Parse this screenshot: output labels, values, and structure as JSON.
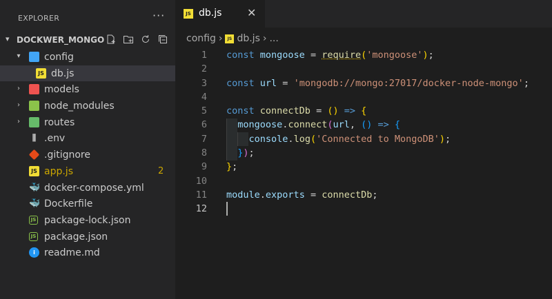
{
  "explorer": {
    "title": "EXPLORER",
    "more": "···",
    "project": "DOCKWER_MONGO",
    "items": [
      {
        "label": "config"
      },
      {
        "label": "db.js"
      },
      {
        "label": "models"
      },
      {
        "label": "node_modules"
      },
      {
        "label": "routes"
      },
      {
        "label": ".env"
      },
      {
        "label": ".gitignore"
      },
      {
        "label": "app.js",
        "badge": "2"
      },
      {
        "label": "docker-compose.yml"
      },
      {
        "label": "Dockerfile"
      },
      {
        "label": "package-lock.json"
      },
      {
        "label": "package.json"
      },
      {
        "label": "readme.md"
      }
    ]
  },
  "tab": {
    "label": "db.js",
    "close": "✕",
    "icon": "JS"
  },
  "breadcrumb": {
    "folder": "config",
    "file": "db.js",
    "rest": "..."
  },
  "editor": {
    "line_numbers": [
      "1",
      "2",
      "3",
      "4",
      "5",
      "6",
      "7",
      "8",
      "9",
      "10",
      "11",
      "12"
    ],
    "code": {
      "l1": {
        "kw": "const",
        "name": "mongoose",
        "eq": " = ",
        "fn": "require",
        "arg": "'mongoose'",
        "end": ";"
      },
      "l3": {
        "kw": "const",
        "name": "url",
        "eq": " = ",
        "str": "'mongodb://mongo:27017/docker-node-mongo'",
        "end": ";"
      },
      "l5": {
        "kw": "const",
        "name": "connectDb",
        "eq": " = ",
        "arrow": " => "
      },
      "l6": {
        "obj": "mongoose",
        "dot": ".",
        "fn": "connect",
        "arg": "url",
        "comma": ", ",
        "arrow": " => "
      },
      "l7": {
        "obj": "console",
        "dot": ".",
        "fn": "log",
        "arg": "'Connected to MongoDB'",
        "end": ";"
      },
      "l8": {
        "end": ";"
      },
      "l9": {
        "end": ";"
      },
      "l11": {
        "obj": "module",
        "dot": ".",
        "prop": "exports",
        "eq": " = ",
        "val": "connectDb",
        "end": ";"
      }
    }
  },
  "colors": {
    "accent": "#0e639c",
    "badge": "#cca700",
    "keyword": "#569cd6",
    "string": "#ce9178",
    "function": "#dcdcaa",
    "variable": "#9cdcfe"
  }
}
